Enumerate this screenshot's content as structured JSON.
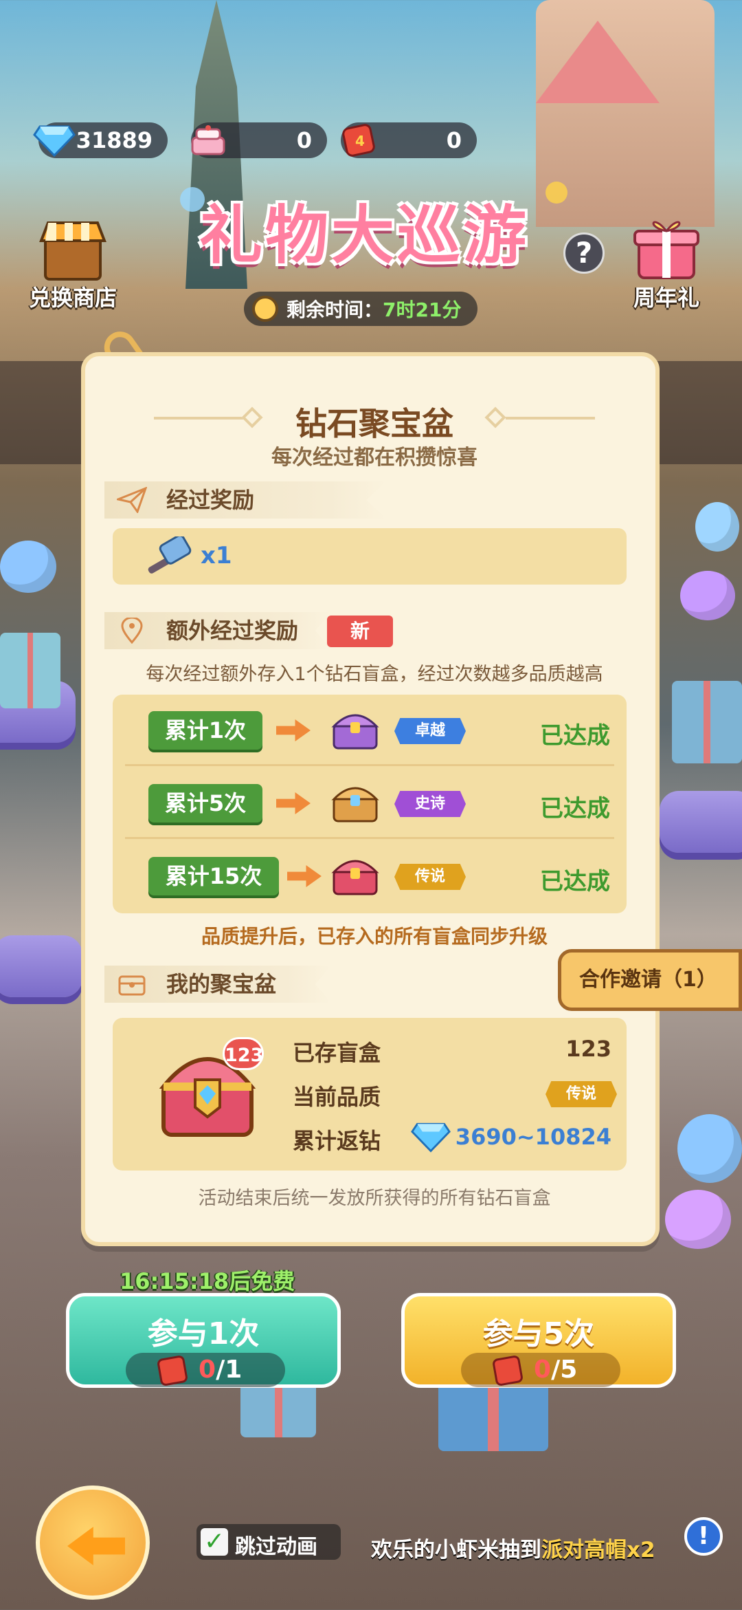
{
  "currencies": [
    {
      "icon": "diamond-icon",
      "value": "31889"
    },
    {
      "icon": "cake-icon",
      "value": "0"
    },
    {
      "icon": "dice-icon",
      "value": "0"
    }
  ],
  "header": {
    "title": "礼物大巡游",
    "help_icon": "question-icon",
    "shop_label": "兑换商店",
    "anniversary_label": "周年礼",
    "remaining_label": "剩余时间：",
    "remaining_value": "7时21分"
  },
  "panel": {
    "title": "钻石聚宝盆",
    "subtitle": "每次经过都在积攒惊喜",
    "pass_reward": {
      "heading": "经过奖励",
      "item_icon": "hammer-icon",
      "quantity": "x1"
    },
    "extra_reward": {
      "heading": "额外经过奖励",
      "badge": "新",
      "description": "每次经过额外存入1个钻石盲盒，经过次数越多品质越高",
      "tiers": [
        {
          "label": "累计1次",
          "quality": "卓越",
          "quality_color": "#3d7fe0",
          "status": "已达成"
        },
        {
          "label": "累计5次",
          "quality": "史诗",
          "quality_color": "#a04fd6",
          "status": "已达成"
        },
        {
          "label": "累计15次",
          "quality": "传说",
          "quality_color": "#e0a21e",
          "status": "已达成"
        }
      ],
      "note": "品质提升后，已存入的所有盲盒同步升级"
    },
    "my_vault": {
      "heading": "我的聚宝盆",
      "chest_count": "123",
      "stored_label": "已存盲盒",
      "stored_value": "123",
      "quality_label": "当前品质",
      "quality_value": "传说",
      "refund_label": "累计返钻",
      "refund_value": "3690~10824"
    },
    "footer_note": "活动结束后统一发放所获得的所有钻石盲盒"
  },
  "coop_button": "合作邀请（1）",
  "free_timer": "16:15:18后免费",
  "actions": [
    {
      "label": "参与1次",
      "cost_have": "0",
      "cost_need": "/1"
    },
    {
      "label": "参与5次",
      "cost_have": "0",
      "cost_need": "/5"
    }
  ],
  "skip_animation": {
    "checked": true,
    "label": "跳过动画"
  },
  "ticker": {
    "prefix": "欢乐的小虾米抽到",
    "item": "派对高帽x2"
  },
  "colors": {
    "accent_green": "#4d9b3b",
    "panel_bg": "#fbf3de",
    "done_green": "#3e9a2e"
  }
}
